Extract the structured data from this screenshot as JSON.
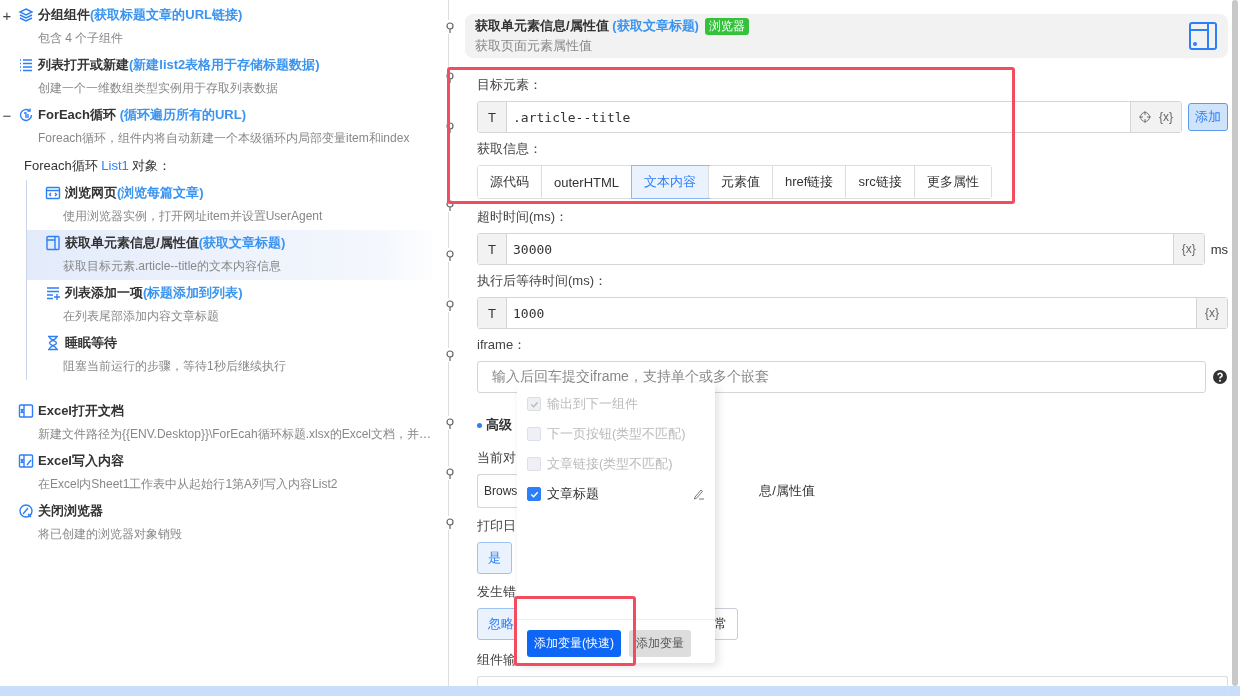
{
  "tree": [
    {
      "kind": "group",
      "expander": "+",
      "title": "分组组件",
      "note": "(获取标题文章的URL链接)",
      "description": "包含 4 个子组件",
      "selected": false
    },
    {
      "kind": "list-open",
      "title": "列表打开或新建",
      "note": "(新建list2表格用于存储标题数据)",
      "description": "创建一个一维数组类型实例用于存取列表数据",
      "selected": false
    },
    {
      "kind": "loop",
      "expander": "−",
      "title": "ForEach循环",
      "note": " (循环遍历所有的URL)",
      "description": "Foreach循环，组件内将自动新建一个本级循环内局部变量item和index",
      "selected": false,
      "loop_label": {
        "text": "Foreach循环",
        "variable": "List1",
        "suffix": "对象："
      },
      "children": [
        {
          "kind": "browse",
          "title": "浏览网页",
          "note": "(浏览每篇文章)",
          "description": "使用浏览器实例，打开网址item并设置UserAgent",
          "selected": false
        },
        {
          "kind": "get-element",
          "title": "获取单元素信息/属性值",
          "note": "(获取文章标题)",
          "description": "获取目标元素.article--title的文本内容信息",
          "selected": true
        },
        {
          "kind": "list-add",
          "title": "列表添加一项",
          "note": "(标题添加到列表)",
          "description": "在列表尾部添加内容文章标题",
          "selected": false
        },
        {
          "kind": "sleep",
          "title": "睡眠等待",
          "description": "阻塞当前运行的步骤，等待1秒后继续执行",
          "selected": false
        }
      ]
    },
    {
      "kind": "excel-open",
      "title": "Excel打开文档",
      "description": "新建文件路径为{{ENV.Desktop}}\\ForEcah循环标题.xlsx的Excel文档，并…",
      "selected": false
    },
    {
      "kind": "excel-write",
      "title": "Excel写入内容",
      "description": "在Excel内Sheet1工作表中从起始行1第A列写入内容List2",
      "selected": false
    },
    {
      "kind": "close-browser",
      "title": "关闭浏览器",
      "description": "将已创建的浏览器对象销毁",
      "selected": false
    }
  ],
  "header": {
    "title": "获取单元素信息/属性值",
    "note": "(获取文章标题)",
    "tag": "浏览器",
    "description": "获取页面元素属性值"
  },
  "target": {
    "label": "目标元素：",
    "prefix": "T",
    "value": ".article--title",
    "variable": "{x}",
    "add_button": "添加"
  },
  "info": {
    "label": "获取信息：",
    "options": [
      {
        "label": "源代码",
        "selected": false
      },
      {
        "label": "outerHTML",
        "selected": false
      },
      {
        "label": "文本内容",
        "selected": true
      },
      {
        "label": "元素值",
        "selected": false
      },
      {
        "label": "href链接",
        "selected": false
      },
      {
        "label": "src链接",
        "selected": false
      },
      {
        "label": "更多属性",
        "selected": false
      }
    ]
  },
  "timeout": {
    "label": "超时时间(ms)：",
    "prefix": "T",
    "value": "30000",
    "variable": "{x}",
    "unit": "ms"
  },
  "wait": {
    "label": "执行后等待时间(ms)：",
    "prefix": "T",
    "value": "1000",
    "variable": "{x}"
  },
  "iframe": {
    "label": "iframe：",
    "placeholder": "输入后回车提交iframe，支持单个或多个嵌套"
  },
  "advanced": {
    "title": "高级",
    "object_label": "当前对",
    "object_value": "Brows",
    "object_tail": "息/属性值",
    "log_label": "打印日",
    "log_options": [
      {
        "label": "是",
        "selected": true
      }
    ],
    "error_label": "发生错",
    "error_options": [
      {
        "label": "忽略",
        "selected": true
      },
      {
        "label": "常",
        "selected": false
      }
    ],
    "output_label": "组件输"
  },
  "popup": {
    "options": [
      {
        "label": "输出到下一组件",
        "checked": true,
        "disabled": true,
        "editable": false
      },
      {
        "label": "下一页按钮(类型不匹配)",
        "checked": false,
        "disabled": true,
        "editable": false
      },
      {
        "label": "文章链接(类型不匹配)",
        "checked": false,
        "disabled": true,
        "editable": false
      },
      {
        "label": "文章标题",
        "checked": true,
        "disabled": false,
        "editable": true
      }
    ],
    "buttons": [
      {
        "label": "添加变量(快速)",
        "kind": "primary"
      },
      {
        "label": "添加变量",
        "kind": "secondary"
      }
    ]
  }
}
